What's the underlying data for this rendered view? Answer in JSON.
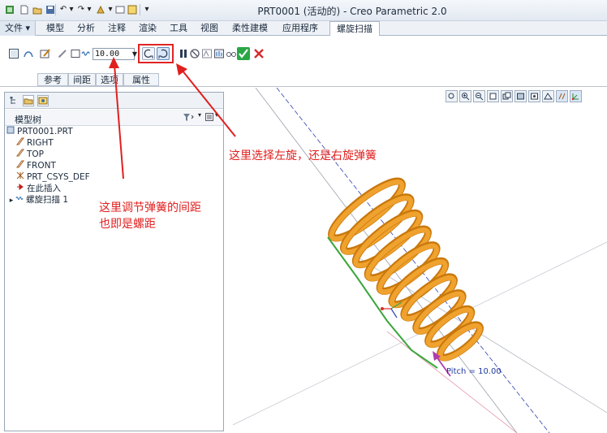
{
  "window": {
    "title": "PRT0001 (活动的) - Creo Parametric 2.0"
  },
  "menu_tabs": [
    "文件",
    "模型",
    "分析",
    "注释",
    "渲染",
    "工具",
    "视图",
    "柔性建模",
    "应用程序",
    "螺旋扫描"
  ],
  "active_tab_index": 9,
  "ribbon": {
    "pitch_value": "10.00",
    "sub_tabs": [
      "参考",
      "间距",
      "选项",
      "属性"
    ]
  },
  "model_tree": {
    "title": "模型树",
    "items": [
      {
        "label": "PRT0001.PRT",
        "icon": "part-icon"
      },
      {
        "label": "RIGHT",
        "icon": "datum-plane-icon"
      },
      {
        "label": "TOP",
        "icon": "datum-plane-icon"
      },
      {
        "label": "FRONT",
        "icon": "datum-plane-icon"
      },
      {
        "label": "PRT_CSYS_DEF",
        "icon": "coordinate-system-icon"
      },
      {
        "label": "在此插入",
        "icon": "insert-arrow-icon"
      },
      {
        "label": "螺旋扫描 1",
        "icon": "helical-sweep-icon"
      }
    ]
  },
  "annotations": {
    "pitch_note_line1": "这里调节弹簧的间距",
    "pitch_note_line2": "也即是螺距",
    "handedness_note": "这里选择左旋，还是右旋弹簧"
  },
  "viewport": {
    "pitch_label": "Pitch = 10.00"
  },
  "colors": {
    "spring": "#f0a22e",
    "spring_dark": "#c9780c",
    "annotation": "#e0201f",
    "ok_green": "#2aa745",
    "cancel_red": "#d92a2a",
    "profile_green": "#3aa63a",
    "axis_blue": "#2b3fb0"
  }
}
